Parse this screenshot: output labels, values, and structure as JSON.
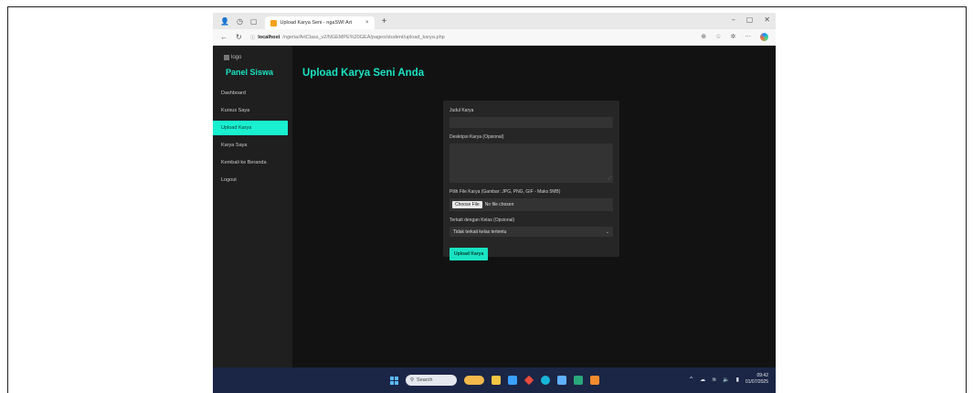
{
  "browser": {
    "tab_title": "Upload Karya Seni - ngaSWI Art",
    "tab_close": "×",
    "new_tab": "+",
    "url_host": "localhost",
    "url_path": "/ngeria/ArtClass_v2/NGEMPE%20GEA/pages/student/upload_karya.php"
  },
  "app": {
    "logo_alt": "logo",
    "panel_title": "Panel Siswa",
    "page_title": "Upload Karya Seni Anda",
    "nav": [
      {
        "label": "Dashboard",
        "active": false
      },
      {
        "label": "Kursus Saya",
        "active": false
      },
      {
        "label": "Upload Karya",
        "active": true
      },
      {
        "label": "Karya Saya",
        "active": false
      },
      {
        "label": "Kembali ke Beranda",
        "active": false
      },
      {
        "label": "Logout",
        "active": false
      }
    ]
  },
  "form": {
    "title_label": "Judul Karya",
    "desc_label": "Deskripsi Karya (Opsional)",
    "file_label": "Pilih File Karya (Gambar: JPG, PNG, GIF - Maks 5MB)",
    "file_button": "Choose File",
    "file_status": "No file chosen",
    "course_label": "Terkait dengan Kelas (Opsional)",
    "course_selected": "Tidak terkait kelas tertentu",
    "submit_label": "Upload Karya"
  },
  "taskbar": {
    "search_placeholder": "Search",
    "time": "09:42",
    "date": "01/07/2025"
  },
  "colors": {
    "accent": "#19e3c2",
    "sidebar_bg": "#1f1f1f",
    "content_bg": "#121212",
    "form_bg": "#262626",
    "taskbar_bg": "#1b2545"
  }
}
